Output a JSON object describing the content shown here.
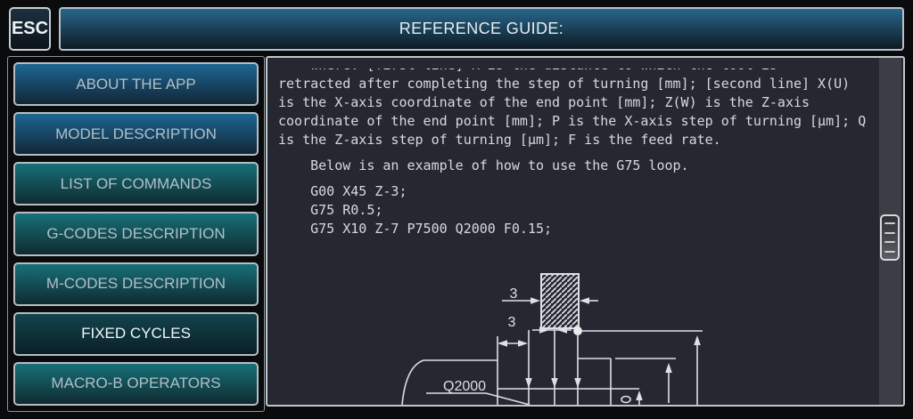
{
  "header": {
    "esc_label": "ESC",
    "title": "REFERENCE GUIDE:"
  },
  "sidebar": {
    "items": [
      {
        "label": "ABOUT THE APP",
        "style": "blue",
        "active": false
      },
      {
        "label": "MODEL DESCRIPTION",
        "style": "blue",
        "active": false
      },
      {
        "label": "LIST OF COMMANDS",
        "style": "teal",
        "active": false
      },
      {
        "label": "G-CODES DESCRIPTION",
        "style": "teal",
        "active": false
      },
      {
        "label": "M-CODES DESCRIPTION",
        "style": "teal",
        "active": false
      },
      {
        "label": "FIXED CYCLES",
        "style": "dark",
        "active": true
      },
      {
        "label": "MACRO-B OPERATORS",
        "style": "teal",
        "active": false
      }
    ]
  },
  "content": {
    "lines": [
      {
        "t": "    where: [first line] R is the distance to which the tool is",
        "gap": false
      },
      {
        "t": "retracted after completing the step of turning [mm]; [second line] X(U)",
        "gap": false
      },
      {
        "t": "is the X-axis coordinate of the end point [mm]; Z(W) is the Z-axis",
        "gap": false
      },
      {
        "t": "coordinate of the end point [mm]; P is the X-axis step of turning [μm]; Q",
        "gap": false
      },
      {
        "t": "is the Z-axis step of turning [μm]; F is the feed rate.",
        "gap": false
      },
      {
        "t": "    Below is an example of how to use the G75 loop.",
        "gap": true
      },
      {
        "t": "    G00 X45 Z-3;",
        "gap": true
      },
      {
        "t": "    G75 R0.5;",
        "gap": false
      },
      {
        "t": "    G75 X10 Z-7 P7500 Q2000 F0.15;",
        "gap": false
      }
    ]
  },
  "diagram": {
    "dim_tool_width": "3",
    "dim_step": "3",
    "q_label": "Q2000"
  },
  "colors": {
    "button_blue_top": "#1c6793",
    "button_teal_top": "#177077",
    "button_active_top": "#12444d",
    "panel_background": "#252830",
    "text_color": "#d6dade",
    "line_color": "#dde1e5"
  }
}
